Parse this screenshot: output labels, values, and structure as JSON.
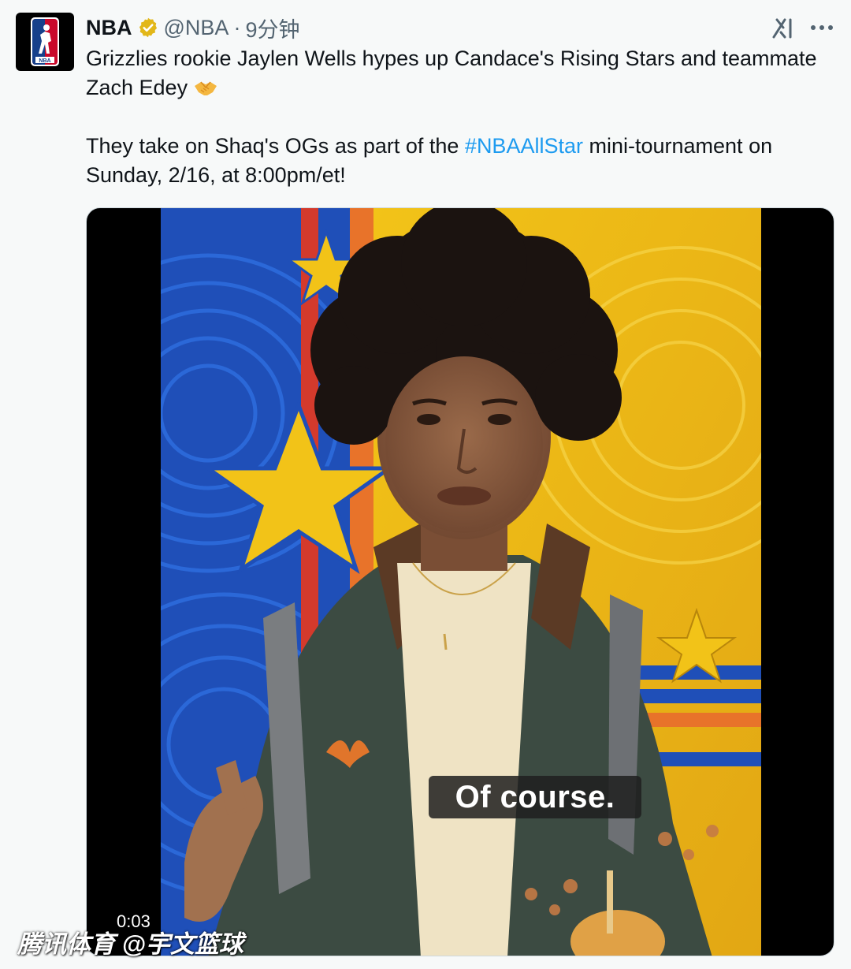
{
  "account": {
    "name": "NBA",
    "handle": "@NBA",
    "separator": "·",
    "time": "9分钟"
  },
  "icons": {
    "avatar": "nba-logo-icon",
    "verified": "verified-badge-icon",
    "grok": "grok-icon",
    "more": "more-options-icon",
    "handshake": "handshake-emoji"
  },
  "tweet": {
    "line1": "Grizzlies rookie Jaylen Wells hypes up Candace's Rising Stars and teammate Zach Edey",
    "line2_pre": "They take on Shaq's OGs as part of the ",
    "hashtag": "#NBAAllStar",
    "line2_post": " mini-tournament on Sunday, 2/16, at 8:00pm/et!"
  },
  "video": {
    "subtitle": "Of course.",
    "timestamp": "0:03"
  },
  "watermark": "腾讯体育 @宇文篮球",
  "colors": {
    "link": "#1d9bf0",
    "verified": "#e2b719",
    "background": "#f7f9f9",
    "muted": "#536471"
  }
}
